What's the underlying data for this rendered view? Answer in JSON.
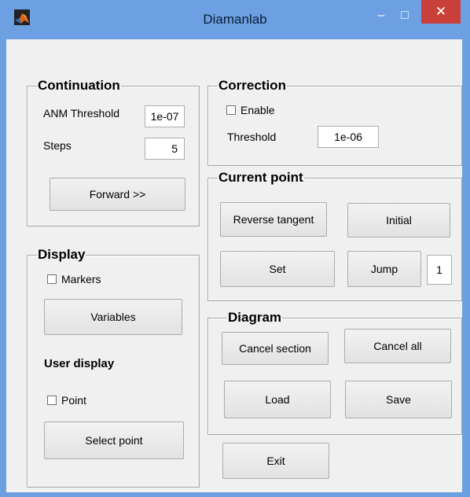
{
  "window": {
    "title": "Diamanlab",
    "controls": {
      "minimize": "–",
      "maximize": "□",
      "close": "✕"
    },
    "accent_color": "#6ca0e2",
    "close_color": "#c9403a"
  },
  "continuation": {
    "title": "Continuation",
    "anm_threshold_label": "ANM Threshold",
    "anm_threshold_value": "1e-07",
    "steps_label": "Steps",
    "steps_value": "5",
    "forward_label": "Forward  >>"
  },
  "correction": {
    "title": "Correction",
    "enable_label": "Enable",
    "enable_checked": false,
    "threshold_label": "Threshold",
    "threshold_value": "1e-06"
  },
  "current_point": {
    "title": "Current point",
    "reverse_tangent_label": "Reverse tangent",
    "initial_label": "Initial",
    "set_label": "Set",
    "jump_label": "Jump",
    "jump_value": "1"
  },
  "display": {
    "title": "Display",
    "markers_label": "Markers",
    "markers_checked": false,
    "variables_label": "Variables",
    "user_display_label": "User display",
    "point_label": "Point",
    "point_checked": false,
    "select_point_label": "Select point"
  },
  "diagram": {
    "title": "Diagram",
    "cancel_section_label": "Cancel section",
    "cancel_all_label": "Cancel all",
    "load_label": "Load",
    "save_label": "Save"
  },
  "exit_label": "Exit"
}
